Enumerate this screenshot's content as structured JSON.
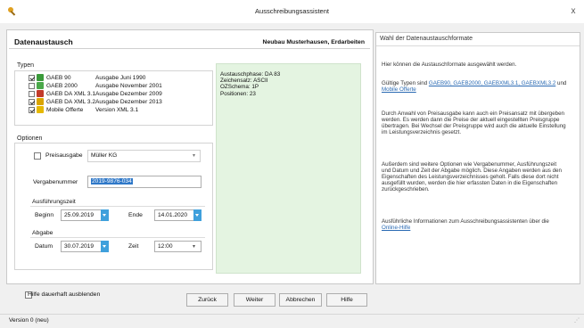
{
  "window": {
    "title": "Ausschreibungsassistent",
    "close_glyph": "x"
  },
  "header": {
    "title": "Datenaustausch",
    "project": "Neubau Musterhausen, Erdarbeiten"
  },
  "typen": {
    "label": "Typen",
    "items": [
      {
        "name": "GAEB 90",
        "version": "Ausgabe Juni 1990",
        "checked": true,
        "icon": "gaeb-icon",
        "color": "#3a9a3a"
      },
      {
        "name": "GAEB 2000",
        "version": "Ausgabe November 2001",
        "checked": false,
        "icon": "gaeb-icon",
        "color": "#4aa84a"
      },
      {
        "name": "GAEB DA XML 3.1",
        "version": "Ausgabe Dezember 2009",
        "checked": false,
        "icon": "gaeb-icon",
        "color": "#c23a2a"
      },
      {
        "name": "GAEB DA XML 3.2",
        "version": "Ausgabe Dezember 2013",
        "checked": true,
        "icon": "gaeb-icon",
        "color": "#d9a400"
      },
      {
        "name": "Mobile Offerte",
        "version": "Version XML 3.1",
        "checked": true,
        "icon": "mobile-offerte-icon",
        "color": "#e6b800"
      }
    ]
  },
  "optionen": {
    "label": "Optionen",
    "preisausgabe_label": "Preisausgabe",
    "preisausgabe_checked": false,
    "preisgruppe_value": "Müller KG",
    "vergabenummer_label": "Vergabenummer",
    "vergabenummer_value": "2019-9876-034",
    "ausfuehrungszeit": {
      "label": "Ausführungszeit",
      "beginn_label": "Beginn",
      "beginn_value": "25.09.2019",
      "ende_label": "Ende",
      "ende_value": "14.01.2020"
    },
    "abgabe": {
      "label": "Abgabe",
      "datum_label": "Datum",
      "datum_value": "30.07.2019",
      "zeit_label": "Zeit",
      "zeit_value": "12:00"
    }
  },
  "info": {
    "lines": [
      "Austauschphase: DA 83",
      "Zeichensatz: ASCII",
      "OZSchema: 1P",
      "Positionen: 23"
    ]
  },
  "help": {
    "title": "Wahl der Datenaustauschformate",
    "p1": "Hier können die Austauschformate ausgewählt werden.",
    "p2_prefix": "Gültige Typen sind",
    "p2_links": "GAEB90, GAEB2000, GAEBXML3.1, GAEBXML3.2",
    "p2_and": "und",
    "p2_link2": "Mobile Offerte",
    "p3": "Durch Anwahl von Preisausgabe kann auch ein Preisansatz mit übergeben werden. Es werden dann die Preise der aktuell eingestellten Preisgruppe übertragen. Bei Wechsel der Preisgruppe wird auch die aktuelle Einstellung im Leistungsverzeichnis gesetzt.",
    "p4": "Außerdem sind weitere Optionen wie Vergabenummer, Ausführungszeit und Datum und Zeit der Abgabe möglich. Diese Angaben werden aus den Eigenschaften des Leistungsverzeichnisses geholt. Falls diese dort nicht ausgefüllt wurden, werden die hier erfassten Daten in die Eigenschaften zurückgeschrieben.",
    "p5_prefix": "Ausführliche Informationen zum Ausschreibungsassistenten über die",
    "p5_link": "Online-Hilfe"
  },
  "footer": {
    "hide_help_label": "Hilfe dauerhaft ausblenden",
    "buttons": {
      "back": "Zurück",
      "next": "Weiter",
      "cancel": "Abbrechen",
      "help": "Hilfe"
    }
  },
  "status": {
    "text": "Version 0 (neu)"
  }
}
